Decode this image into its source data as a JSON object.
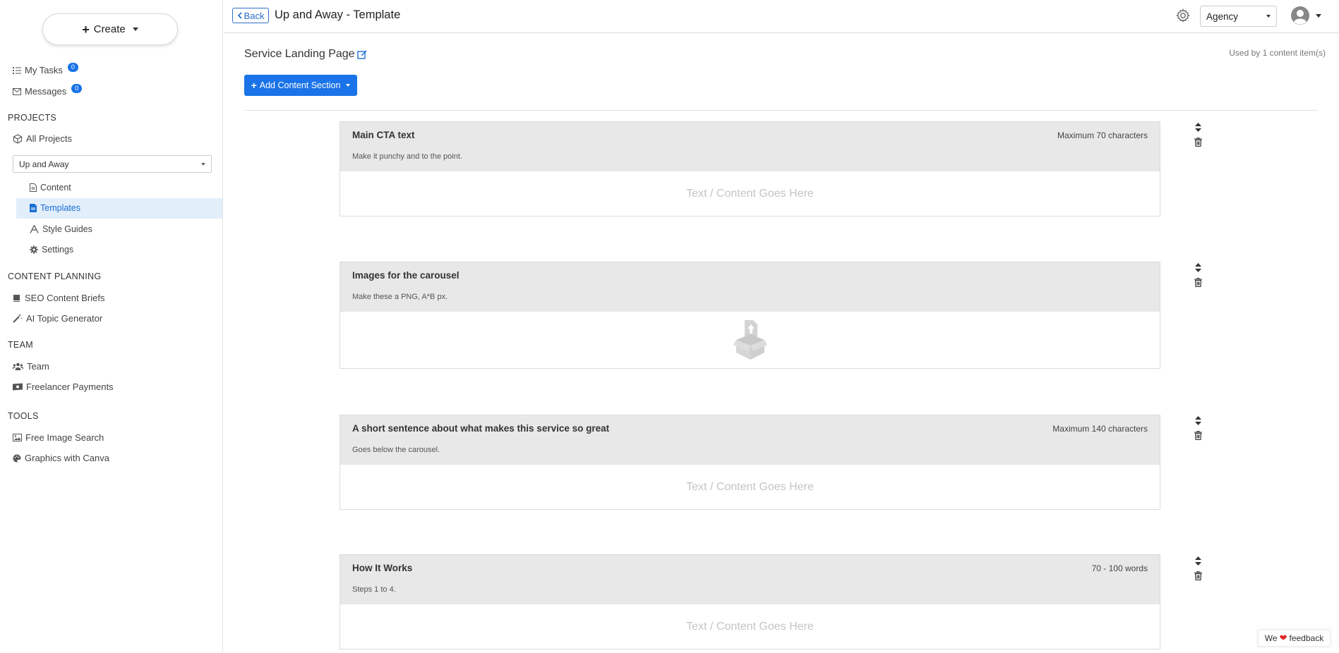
{
  "sidebar": {
    "create_label": "Create",
    "my_tasks": {
      "label": "My Tasks",
      "count": "0"
    },
    "messages": {
      "label": "Messages",
      "count": "0"
    },
    "projects_heading": "PROJECTS",
    "all_projects": "All Projects",
    "project_select": "Up and Away",
    "project_items": [
      "Content",
      "Templates",
      "Style Guides",
      "Settings"
    ],
    "content_planning_heading": "CONTENT PLANNING",
    "content_planning_items": [
      "SEO Content Briefs",
      "AI Topic Generator"
    ],
    "team_heading": "TEAM",
    "team_items": [
      "Team",
      "Freelancer Payments"
    ],
    "tools_heading": "TOOLS",
    "tools_items": [
      "Free Image Search",
      "Graphics with Canva"
    ]
  },
  "topbar": {
    "back_label": "Back",
    "title": "Up and Away - Template",
    "account_select": "Agency"
  },
  "main": {
    "doc_name": "Service Landing Page",
    "used_by": "Used by 1 content item(s)",
    "add_section_label": "Add Content Section",
    "sections": [
      {
        "title": "Main CTA text",
        "limit": "Maximum 70 characters",
        "description": "Make it punchy and to the point.",
        "placeholder": "Text / Content Goes Here"
      },
      {
        "title": "Images for the carousel",
        "limit": "",
        "description": "Make these a PNG, A*B px.",
        "placeholder": ""
      },
      {
        "title": "A short sentence about what makes this service so great",
        "limit": "Maximum 140 characters",
        "description": "Goes below the carousel.",
        "placeholder": "Text / Content Goes Here"
      },
      {
        "title": "How It Works",
        "limit": "70 - 100 words",
        "description": "Steps 1 to 4.",
        "placeholder": "Text / Content Goes Here"
      }
    ]
  },
  "feedback": {
    "before": "We",
    "after": "feedback"
  },
  "colors": {
    "accent": "#1a73e8",
    "active_bg": "#e3eefb",
    "card_head": "#e8e8e8"
  }
}
